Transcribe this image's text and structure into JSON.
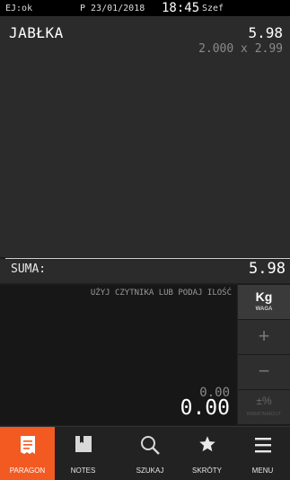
{
  "status": {
    "ej": "EJ:ok",
    "date": "P 23/01/2018",
    "time": "18:45",
    "user": "Szef"
  },
  "receipt": {
    "lines": [
      {
        "name": "JABŁKA",
        "total": "5.98",
        "detail": "2.000 x 2.99"
      }
    ]
  },
  "sum": {
    "label": "SUMA:",
    "value": "5.98"
  },
  "input": {
    "hint": "UŻYJ CZYTNIKA LUB PODAJ ILOŚĆ",
    "qty_small": "0.00",
    "qty_big": "0.00"
  },
  "side_keys": {
    "unit": "Kg",
    "unit_sub": "WAGA",
    "plus": "+",
    "minus": "−",
    "discount": "±%",
    "discount_sub": "RABAT/NARZUT"
  },
  "tabs": [
    {
      "label": "PARAGON",
      "icon": "receipt-icon",
      "active": true
    },
    {
      "label": "NOTES",
      "icon": "notebook-icon"
    },
    {
      "label": "SZUKAJ",
      "icon": "search-icon"
    },
    {
      "label": "SKRÓTY",
      "icon": "star-icon"
    },
    {
      "label": "MENU",
      "icon": "hamburger-icon"
    }
  ],
  "colors": {
    "accent": "#f25a22",
    "background": "#1e1e1e"
  }
}
